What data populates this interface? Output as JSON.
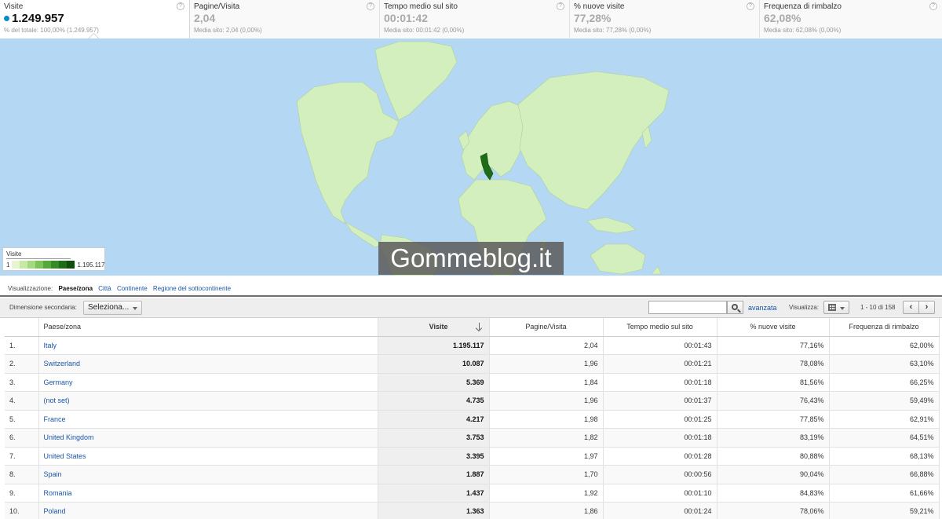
{
  "metrics": [
    {
      "label": "Visite",
      "value": "1.249.957",
      "sub": "% del totale: 100,00% (1.249.957)"
    },
    {
      "label": "Pagine/Visita",
      "value": "2,04",
      "sub": "Media sito: 2,04 (0,00%)"
    },
    {
      "label": "Tempo medio sul sito",
      "value": "00:01:42",
      "sub": "Media sito: 00:01:42 (0,00%)"
    },
    {
      "label": "% nuove visite",
      "value": "77,28%",
      "sub": "Media sito: 77,28% (0,00%)"
    },
    {
      "label": "Frequenza di rimbalzo",
      "value": "62,08%",
      "sub": "Media sito: 62,08% (0,00%)"
    }
  ],
  "help_glyph": "?",
  "accent_color": "#058dc7",
  "map": {
    "legend_title": "Visite",
    "legend_min": "1",
    "legend_max": "1.195.117",
    "legend_colors": [
      "#e6f5d0",
      "#c7e9a8",
      "#a3d97f",
      "#7cc35c",
      "#56a83d",
      "#378a28",
      "#1f6b17",
      "#0f4f0c"
    ],
    "watermark": "Gommeblog.it"
  },
  "viz": {
    "label": "Visualizzazione:",
    "tabs": [
      "Paese/zona",
      "Città",
      "Continente",
      "Regione del sottocontinente"
    ]
  },
  "toolbar": {
    "secondary_label": "Dimensione secondaria:",
    "secondary_value": "Seleziona...",
    "search_value": "",
    "advanced": "avanzata",
    "view_label": "Visualizza:",
    "range": "1 - 10 di 158",
    "prev": "‹",
    "next": "›"
  },
  "table": {
    "headers": [
      "",
      "Paese/zona",
      "Visite",
      "Pagine/Visita",
      "Tempo medio sul sito",
      "% nuove visite",
      "Frequenza di rimbalzo"
    ],
    "rows": [
      [
        "1.",
        "Italy",
        "1.195.117",
        "2,04",
        "00:01:43",
        "77,16%",
        "62,00%"
      ],
      [
        "2.",
        "Switzerland",
        "10.087",
        "1,96",
        "00:01:21",
        "78,08%",
        "63,10%"
      ],
      [
        "3.",
        "Germany",
        "5.369",
        "1,84",
        "00:01:18",
        "81,56%",
        "66,25%"
      ],
      [
        "4.",
        "(not set)",
        "4.735",
        "1,96",
        "00:01:37",
        "76,43%",
        "59,49%"
      ],
      [
        "5.",
        "France",
        "4.217",
        "1,98",
        "00:01:25",
        "77,85%",
        "62,91%"
      ],
      [
        "6.",
        "United Kingdom",
        "3.753",
        "1,82",
        "00:01:18",
        "83,19%",
        "64,51%"
      ],
      [
        "7.",
        "United States",
        "3.395",
        "1,97",
        "00:01:28",
        "80,88%",
        "68,13%"
      ],
      [
        "8.",
        "Spain",
        "1.887",
        "1,70",
        "00:00:56",
        "90,04%",
        "66,88%"
      ],
      [
        "9.",
        "Romania",
        "1.437",
        "1,92",
        "00:01:10",
        "84,83%",
        "61,66%"
      ],
      [
        "10.",
        "Poland",
        "1.363",
        "1,86",
        "00:01:24",
        "78,06%",
        "59,21%"
      ]
    ]
  }
}
